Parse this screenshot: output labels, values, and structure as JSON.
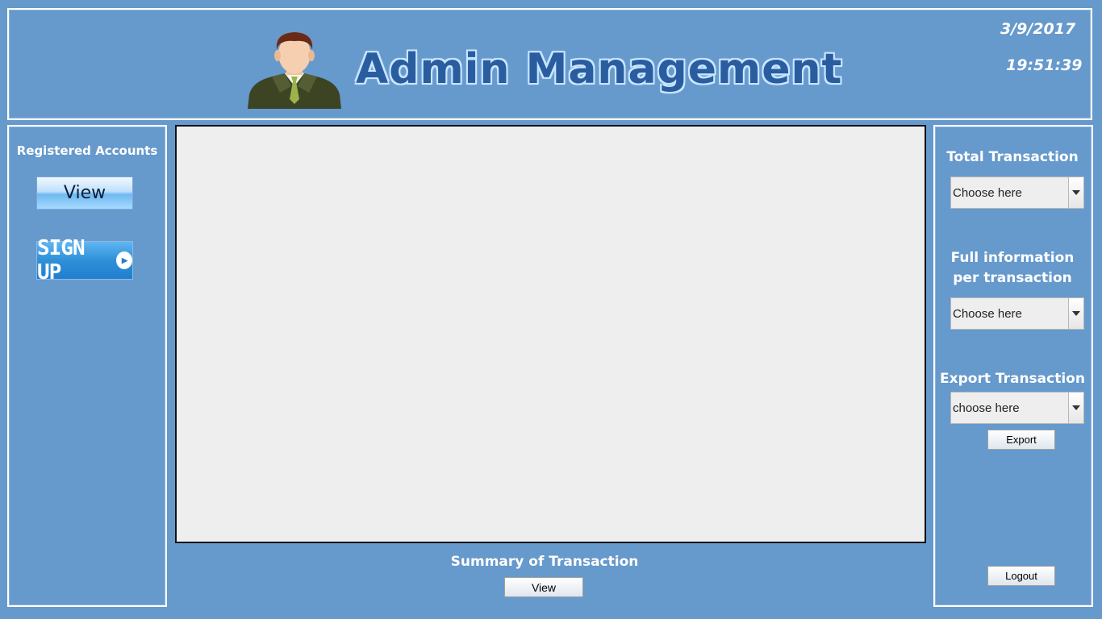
{
  "header": {
    "title": "Admin Management",
    "date": "3/9/2017",
    "time": "19:51:39",
    "avatar_icon": "admin-avatar-icon"
  },
  "left_panel": {
    "heading": "Registered Accounts",
    "view_button": "View",
    "signup_button": "SIGN UP"
  },
  "center": {
    "summary_label": "Summary of Transaction",
    "summary_view_button": "View"
  },
  "right_panel": {
    "total_transaction": {
      "label": "Total Transaction",
      "value": "Choose here"
    },
    "full_info": {
      "label_line1": "Full information",
      "label_line2": "per transaction",
      "value": "Choose here"
    },
    "export_transaction": {
      "label": "Export Transaction",
      "value": "choose here",
      "button": "Export"
    },
    "logout_button": "Logout"
  },
  "colors": {
    "background": "#6699cc",
    "title": "#2a5da0"
  }
}
